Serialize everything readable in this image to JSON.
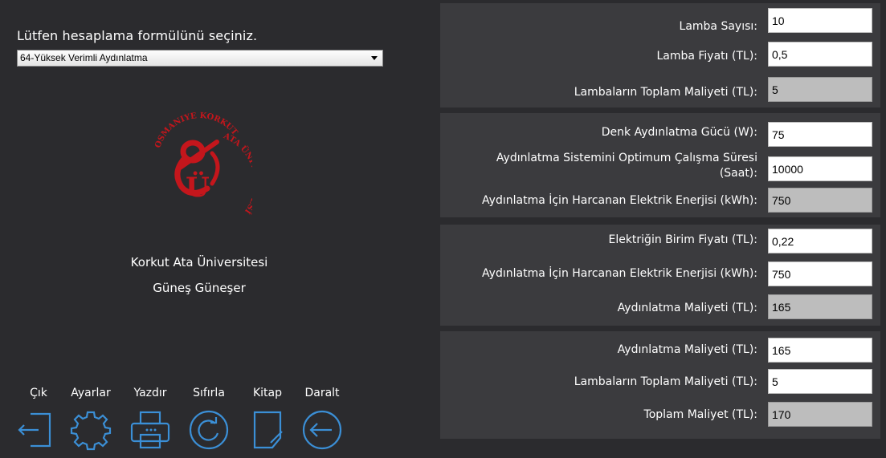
{
  "left": {
    "prompt": "Lütfen hesaplama formülünü seçiniz.",
    "formula_selected": "64-Yüksek Verimli Aydınlatma",
    "logo_text": "OSMANIYE KORKUT ATA ÜNİVERSİTESİ",
    "university": "Korkut Ata Üniversitesi",
    "author": "Güneş Güneşer",
    "toolbar": [
      {
        "label": "Çık",
        "icon": "exit-icon"
      },
      {
        "label": "Ayarlar",
        "icon": "gear-icon"
      },
      {
        "label": "Yazdır",
        "icon": "printer-icon"
      },
      {
        "label": "Sıfırla",
        "icon": "reset-icon"
      },
      {
        "label": "Kitap",
        "icon": "book-icon"
      },
      {
        "label": "Daralt",
        "icon": "back-arrow-icon"
      }
    ]
  },
  "groups": [
    {
      "rows": [
        {
          "label": "Lamba Sayısı:",
          "value": "10",
          "readonly": false
        },
        {
          "label": "Lamba Fiyatı (TL):",
          "value": "0,5",
          "readonly": false
        },
        {
          "label": "Lambaların Toplam Maliyeti (TL):",
          "value": "5",
          "readonly": true
        }
      ]
    },
    {
      "rows": [
        {
          "label": "Denk Aydınlatma Gücü (W):",
          "value": "75",
          "readonly": false
        },
        {
          "label": "Aydınlatma Sistemini Optimum Çalışma Süresi (Saat):",
          "value": "10000",
          "readonly": false
        },
        {
          "label": "Aydınlatma İçin Harcanan Elektrik Enerjisi (kWh):",
          "value": "750",
          "readonly": true
        }
      ]
    },
    {
      "rows": [
        {
          "label": "Elektriğin Birim Fiyatı (TL):",
          "value": "0,22",
          "readonly": false
        },
        {
          "label": "Aydınlatma İçin Harcanan Elektrik Enerjisi (kWh):",
          "value": "750",
          "readonly": false
        },
        {
          "label": "Aydınlatma Maliyeti (TL):",
          "value": "165",
          "readonly": true
        }
      ]
    },
    {
      "rows": [
        {
          "label": "Aydınlatma Maliyeti (TL):",
          "value": "165",
          "readonly": false
        },
        {
          "label": "Lambaların Toplam Maliyeti (TL):",
          "value": "5",
          "readonly": false
        },
        {
          "label": "Toplam Maliyet (TL):",
          "value": "170",
          "readonly": true
        }
      ]
    }
  ],
  "colors": {
    "background": "#2b2b2e",
    "panel": "#3b3b3e",
    "readonly_field": "#bdbdbd",
    "icon_stroke": "#3b8fd6",
    "logo_red": "#c4161c"
  }
}
